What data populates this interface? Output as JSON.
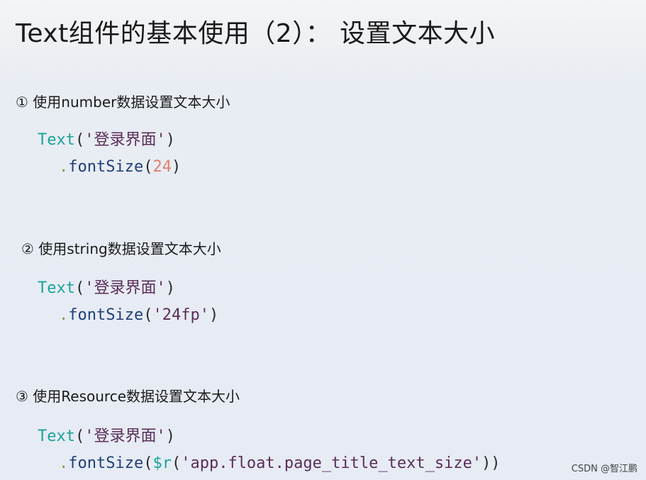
{
  "title": "Text组件的基本使用（2）： 设置文本大小",
  "sections": [
    {
      "heading": "① 使用number数据设置文本大小",
      "line1": {
        "cls": "Text",
        "open": "(",
        "str": "'登录界面'",
        "close": ")"
      },
      "line2": {
        "dot": ".",
        "fn": "fontSize",
        "open": "(",
        "arg": "24",
        "close": ")"
      }
    },
    {
      "heading": "② 使用string数据设置文本大小",
      "line1": {
        "cls": "Text",
        "open": "(",
        "str": "'登录界面'",
        "close": ")"
      },
      "line2": {
        "dot": ".",
        "fn": "fontSize",
        "open": "(",
        "arg": "'24fp'",
        "close": ")"
      }
    },
    {
      "heading": "③ 使用Resource数据设置文本大小",
      "line1": {
        "cls": "Text",
        "open": "(",
        "str": "'登录界面'",
        "close": ")"
      },
      "line2": {
        "dot": ".",
        "fn": "fontSize",
        "open": "(",
        "var": "$r",
        "open2": "(",
        "arg": "'app.float.page_title_text_size'",
        "close": "))"
      }
    }
  ],
  "watermark": "CSDN @智江鹏"
}
